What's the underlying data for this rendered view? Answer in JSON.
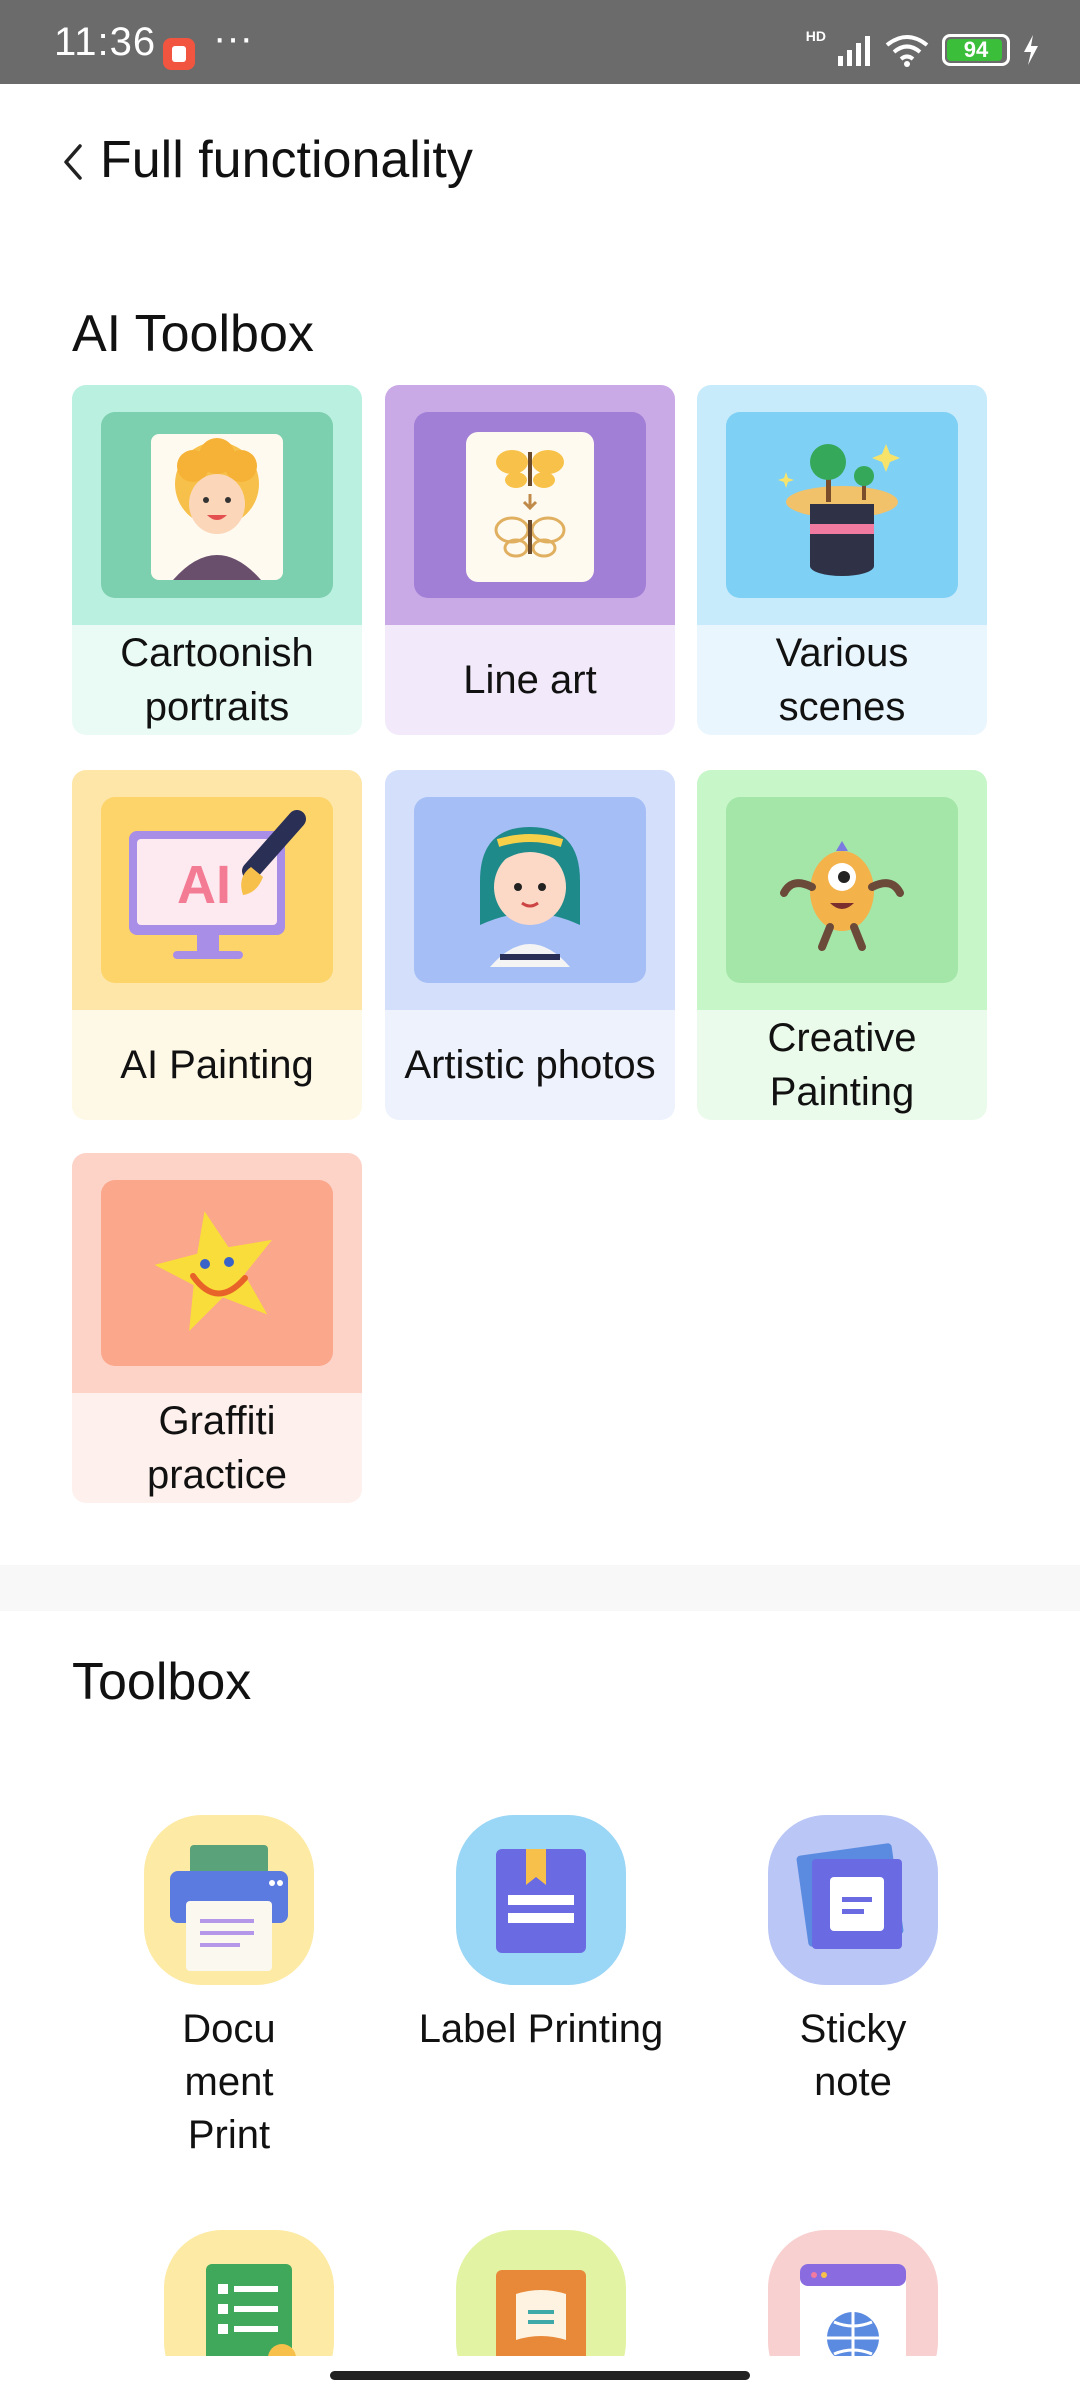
{
  "status_bar": {
    "time": "11:36",
    "dots": "···",
    "network": "HD",
    "battery": "94",
    "battery_level": 0.94
  },
  "header": {
    "title": "Full functionality"
  },
  "ai_toolbox": {
    "title": "AI Toolbox",
    "items": [
      {
        "label": "Cartoonish portraits",
        "top_color": "#b9f0df",
        "bottom_color": "#e9fbf4",
        "inner_color": "#7ccfaf",
        "icon": "cartoon-portrait-icon"
      },
      {
        "label": "Line art",
        "top_color": "#c9aae6",
        "bottom_color": "#f2eafb",
        "inner_color": "#a27fd6",
        "icon": "butterfly-icon"
      },
      {
        "label": "Various scenes",
        "top_color": "#c7ebfb",
        "bottom_color": "#eaf6fd",
        "inner_color": "#7fd0f5",
        "icon": "magic-hat-icon"
      },
      {
        "label": "AI Painting",
        "top_color": "#fde6a8",
        "bottom_color": "#fef9e6",
        "inner_color": "#fdd46a",
        "icon": "ai-monitor-icon"
      },
      {
        "label": "Artistic photos",
        "top_color": "#d4e0fb",
        "bottom_color": "#eef2fd",
        "inner_color": "#a5bef6",
        "icon": "girl-portrait-icon"
      },
      {
        "label": "Creative Painting",
        "top_color": "#c7f6c9",
        "bottom_color": "#ebfbeb",
        "inner_color": "#a4e6a8",
        "icon": "monster-icon"
      },
      {
        "label": "Graffiti practice",
        "top_color": "#fdd3c8",
        "bottom_color": "#fef0ec",
        "inner_color": "#fba78c",
        "icon": "star-icon"
      }
    ]
  },
  "toolbox": {
    "title": "Toolbox",
    "items": [
      {
        "label": "Docu ment Print",
        "icon": "printer-icon"
      },
      {
        "label": "Label Printing",
        "icon": "label-book-icon"
      },
      {
        "label": "Sticky note",
        "icon": "sticky-note-icon"
      },
      {
        "label": "",
        "icon": "list-document-icon"
      },
      {
        "label": "",
        "icon": "scroll-icon"
      },
      {
        "label": "",
        "icon": "web-globe-icon"
      }
    ]
  }
}
